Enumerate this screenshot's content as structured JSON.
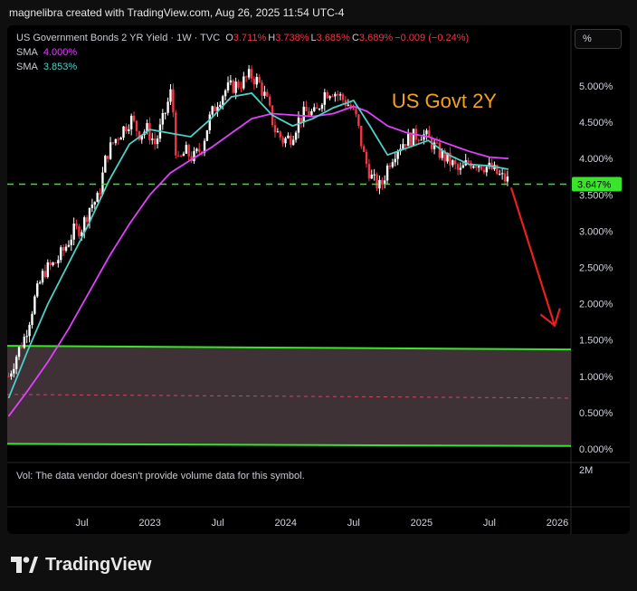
{
  "header": {
    "attribution": "magnelibra created with TradingView.com, Aug 26, 2025 11:54 UTC-4"
  },
  "legend": {
    "symbol": "US Government Bonds 2 YR Yield · 1W · TVC",
    "o_label": "O",
    "o_value": "3.711%",
    "h_label": "H",
    "h_value": "3.738%",
    "l_label": "L",
    "l_value": "3.685%",
    "c_label": "C",
    "c_value": "3.689%",
    "change": "−0.009 (−0.24%)",
    "sma1_label": "SMA",
    "sma1_value": "4.000%",
    "sma1_color": "#e040fb",
    "sma2_label": "SMA",
    "sma2_value": "3.853%",
    "sma2_color": "#4dd0c8"
  },
  "toolbar": {
    "percent_button": "%"
  },
  "volume_note": "Vol: The data vendor doesn't provide volume data for this symbol.",
  "brand": {
    "name": "TradingView"
  },
  "chart_data": {
    "type": "candlestick",
    "annotation": "US Govt 2Y",
    "price_axis_labels": [
      "5.000%",
      "4.500%",
      "4.000%",
      "3.500%",
      "3.000%",
      "2.500%",
      "2.000%",
      "1.500%",
      "1.000%",
      "0.500%",
      "0.000%"
    ],
    "y_range": [
      0.0,
      5.0
    ],
    "volume_axis_label": "2M",
    "time_axis_labels": [
      {
        "label": "Jul",
        "date": 2022.5
      },
      {
        "label": "2023",
        "date": 2023.0
      },
      {
        "label": "Jul",
        "date": 2023.5
      },
      {
        "label": "2024",
        "date": 2024.0
      },
      {
        "label": "Jul",
        "date": 2024.5
      },
      {
        "label": "2025",
        "date": 2025.0
      },
      {
        "label": "Jul",
        "date": 2025.5
      },
      {
        "label": "2026",
        "date": 2026.0
      }
    ],
    "x_range": [
      2021.95,
      2026.1
    ],
    "current_price_label": "3.647%",
    "current_price": 3.647,
    "price_path": [
      [
        2021.96,
        1.0
      ],
      [
        2022.02,
        1.3
      ],
      [
        2022.08,
        1.55
      ],
      [
        2022.15,
        2.05
      ],
      [
        2022.22,
        2.45
      ],
      [
        2022.3,
        2.55
      ],
      [
        2022.37,
        2.75
      ],
      [
        2022.44,
        3.0
      ],
      [
        2022.5,
        3.05
      ],
      [
        2022.56,
        3.35
      ],
      [
        2022.62,
        3.45
      ],
      [
        2022.68,
        4.05
      ],
      [
        2022.74,
        4.25
      ],
      [
        2022.8,
        4.4
      ],
      [
        2022.86,
        4.55
      ],
      [
        2022.92,
        4.35
      ],
      [
        2022.98,
        4.4
      ],
      [
        2023.04,
        4.2
      ],
      [
        2023.1,
        4.55
      ],
      [
        2023.16,
        4.95
      ],
      [
        2023.2,
        3.9
      ],
      [
        2023.26,
        4.1
      ],
      [
        2023.32,
        4.0
      ],
      [
        2023.38,
        4.15
      ],
      [
        2023.44,
        4.55
      ],
      [
        2023.5,
        4.8
      ],
      [
        2023.56,
        4.95
      ],
      [
        2023.62,
        5.0
      ],
      [
        2023.68,
        5.05
      ],
      [
        2023.74,
        5.15
      ],
      [
        2023.8,
        5.05
      ],
      [
        2023.86,
        4.8
      ],
      [
        2023.92,
        4.4
      ],
      [
        2023.98,
        4.25
      ],
      [
        2024.04,
        4.3
      ],
      [
        2024.1,
        4.55
      ],
      [
        2024.16,
        4.65
      ],
      [
        2024.22,
        4.6
      ],
      [
        2024.28,
        4.9
      ],
      [
        2024.34,
        4.95
      ],
      [
        2024.4,
        4.85
      ],
      [
        2024.46,
        4.75
      ],
      [
        2024.52,
        4.55
      ],
      [
        2024.58,
        4.0
      ],
      [
        2024.64,
        3.7
      ],
      [
        2024.7,
        3.6
      ],
      [
        2024.76,
        3.95
      ],
      [
        2024.82,
        4.15
      ],
      [
        2024.88,
        4.25
      ],
      [
        2024.94,
        4.3
      ],
      [
        2025.0,
        4.35
      ],
      [
        2025.06,
        4.25
      ],
      [
        2025.12,
        4.1
      ],
      [
        2025.18,
        4.0
      ],
      [
        2025.24,
        3.9
      ],
      [
        2025.28,
        3.8
      ],
      [
        2025.34,
        3.95
      ],
      [
        2025.4,
        3.95
      ],
      [
        2025.46,
        3.9
      ],
      [
        2025.52,
        3.85
      ],
      [
        2025.58,
        3.75
      ],
      [
        2025.64,
        3.69
      ]
    ],
    "sma_slow": [
      [
        2021.96,
        0.45
      ],
      [
        2022.1,
        0.8
      ],
      [
        2022.25,
        1.2
      ],
      [
        2022.4,
        1.65
      ],
      [
        2022.55,
        2.15
      ],
      [
        2022.7,
        2.65
      ],
      [
        2022.85,
        3.1
      ],
      [
        2023.0,
        3.5
      ],
      [
        2023.15,
        3.8
      ],
      [
        2023.3,
        3.98
      ],
      [
        2023.45,
        4.15
      ],
      [
        2023.6,
        4.35
      ],
      [
        2023.75,
        4.55
      ],
      [
        2023.9,
        4.62
      ],
      [
        2024.05,
        4.6
      ],
      [
        2024.2,
        4.58
      ],
      [
        2024.35,
        4.62
      ],
      [
        2024.5,
        4.72
      ],
      [
        2024.6,
        4.65
      ],
      [
        2024.75,
        4.45
      ],
      [
        2024.9,
        4.35
      ],
      [
        2025.05,
        4.3
      ],
      [
        2025.2,
        4.2
      ],
      [
        2025.35,
        4.1
      ],
      [
        2025.5,
        4.02
      ],
      [
        2025.64,
        4.0
      ]
    ],
    "sma_fast": [
      [
        2021.96,
        0.7
      ],
      [
        2022.1,
        1.35
      ],
      [
        2022.25,
        2.0
      ],
      [
        2022.4,
        2.55
      ],
      [
        2022.55,
        3.1
      ],
      [
        2022.7,
        3.7
      ],
      [
        2022.85,
        4.2
      ],
      [
        2023.0,
        4.4
      ],
      [
        2023.15,
        4.35
      ],
      [
        2023.3,
        4.3
      ],
      [
        2023.45,
        4.55
      ],
      [
        2023.6,
        4.85
      ],
      [
        2023.75,
        4.9
      ],
      [
        2023.9,
        4.6
      ],
      [
        2024.05,
        4.45
      ],
      [
        2024.2,
        4.55
      ],
      [
        2024.35,
        4.7
      ],
      [
        2024.5,
        4.8
      ],
      [
        2024.62,
        4.45
      ],
      [
        2024.75,
        4.05
      ],
      [
        2024.9,
        4.15
      ],
      [
        2025.05,
        4.25
      ],
      [
        2025.2,
        4.05
      ],
      [
        2025.35,
        3.92
      ],
      [
        2025.5,
        3.9
      ],
      [
        2025.64,
        3.853
      ]
    ],
    "horizontal_dashed_line": 3.647,
    "support_zone": {
      "upper_line": [
        [
          2021.95,
          1.42
        ],
        [
          2026.1,
          1.37
        ]
      ],
      "lower_line": [
        [
          2021.95,
          0.07
        ],
        [
          2026.1,
          0.04
        ]
      ],
      "mid_dashed": [
        [
          2021.95,
          0.75
        ],
        [
          2026.1,
          0.7
        ]
      ]
    },
    "projection_arrow": {
      "from": [
        2025.66,
        3.6
      ],
      "to": [
        2025.98,
        1.7
      ]
    },
    "colors": {
      "up": "#ffffff",
      "down": "#f23645",
      "background": "#000000",
      "support_line": "#39e52b",
      "zone_fill": "#4a3b40",
      "dashed_line": "#39e52b",
      "mid_dashed": "#c74a63",
      "arrow": "#e8201e",
      "annotation": "#f5a21b",
      "price_tag": "#39e52b"
    },
    "grid": false,
    "legend_position": "top-left"
  }
}
